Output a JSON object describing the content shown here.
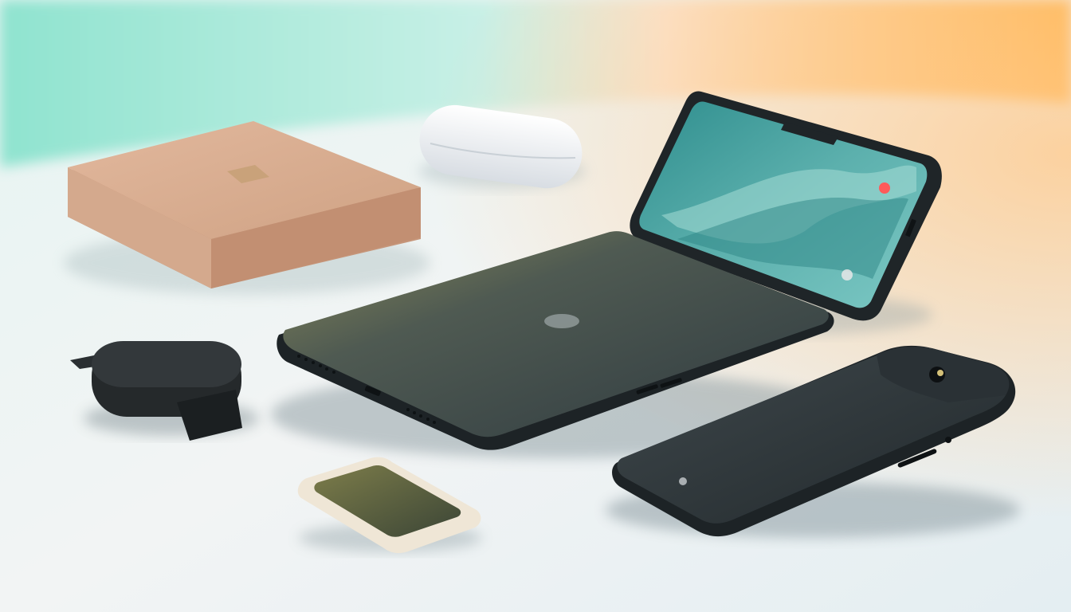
{
  "scene": {
    "palette": {
      "wall_left": "#8fe3cf",
      "wall_right": "#ffb347",
      "surface": "#eef3f3",
      "device_dark": "#2b3236",
      "rose_gold": "#d9ae93",
      "white_case": "#f4f6f8",
      "screen_teal": "#3d9c9a",
      "indicator_red": "#ff5a5a"
    },
    "objects": [
      {
        "name": "rose-gold-mini-box",
        "icon": "square-box"
      },
      {
        "name": "white-earbuds-case",
        "icon": "pill-case"
      },
      {
        "name": "folding-phone-screen",
        "icon": "smartphone"
      },
      {
        "name": "dark-tablet",
        "icon": "tablet"
      },
      {
        "name": "black-earbuds-case",
        "icon": "earbuds-case"
      },
      {
        "name": "small-gold-phone",
        "icon": "smartphone"
      },
      {
        "name": "dark-phone-camera-bump",
        "icon": "smartphone"
      }
    ]
  }
}
